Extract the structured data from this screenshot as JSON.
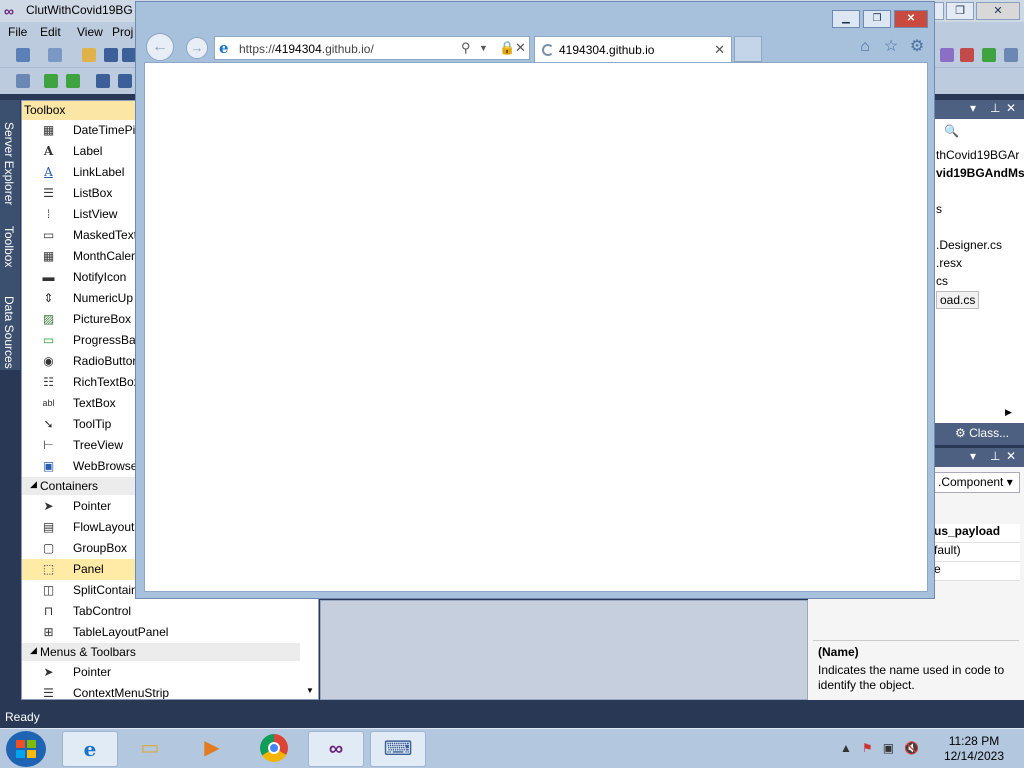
{
  "vs": {
    "title": "ClutWithCovid19BG",
    "menu": [
      "File",
      "Edit",
      "View",
      "Proj"
    ],
    "status": "Ready",
    "side_tabs": [
      "Server Explorer",
      "Toolbox",
      "Data Sources"
    ]
  },
  "toolbox": {
    "header": "Toolbox",
    "items_top": [
      {
        "icon": "datetimepicker-icon",
        "label": "DateTimePi"
      },
      {
        "icon": "label-icon",
        "label": "Label"
      },
      {
        "icon": "linklabel-icon",
        "label": "LinkLabel"
      },
      {
        "icon": "listbox-icon",
        "label": "ListBox"
      },
      {
        "icon": "listview-icon",
        "label": "ListView"
      },
      {
        "icon": "maskedtextbox-icon",
        "label": "MaskedText"
      },
      {
        "icon": "monthcalendar-icon",
        "label": "MonthCaler"
      },
      {
        "icon": "notifyicon-icon",
        "label": "NotifyIcon"
      },
      {
        "icon": "numericupdown-icon",
        "label": "NumericUp"
      },
      {
        "icon": "picturebox-icon",
        "label": "PictureBox"
      },
      {
        "icon": "progressbar-icon",
        "label": "ProgressBar"
      },
      {
        "icon": "radiobutton-icon",
        "label": "RadioButtor"
      },
      {
        "icon": "richtextbox-icon",
        "label": "RichTextBox"
      },
      {
        "icon": "textbox-icon",
        "label": "TextBox"
      },
      {
        "icon": "tooltip-icon",
        "label": "ToolTip"
      },
      {
        "icon": "treeview-icon",
        "label": "TreeView"
      },
      {
        "icon": "webbrowser-icon",
        "label": "WebBrowse"
      }
    ],
    "containers_label": "Containers",
    "containers": [
      {
        "icon": "pointer-icon",
        "label": "Pointer"
      },
      {
        "icon": "flowlayout-icon",
        "label": "FlowLayoutI"
      },
      {
        "icon": "groupbox-icon",
        "label": "GroupBox"
      },
      {
        "icon": "panel-icon",
        "label": "Panel"
      },
      {
        "icon": "splitcontainer-icon",
        "label": "SplitContair"
      },
      {
        "icon": "tabcontrol-icon",
        "label": "TabControl"
      },
      {
        "icon": "tablelayoutpanel-icon",
        "label": "TableLayoutPanel"
      }
    ],
    "menus_label": "Menus & Toolbars",
    "menus": [
      {
        "icon": "pointer-icon",
        "label": "Pointer"
      },
      {
        "icon": "contextmenustrip-icon",
        "label": "ContextMenuStrip"
      }
    ]
  },
  "solution": {
    "lines": [
      "thCovid19BGAr",
      "vid19BGAndMs",
      "s",
      ".Designer.cs",
      ".resx",
      "cs",
      "oad.cs"
    ],
    "tab_label": "Class..."
  },
  "properties": {
    "combo": ".Component",
    "rows": [
      "us_payload",
      "fault)",
      "e"
    ],
    "desc_title": "(Name)",
    "desc_text": "Indicates the name used in code to identify the object."
  },
  "browser": {
    "url_prefix": "https://",
    "url_host": "4194304",
    "url_suffix": ".github.io/",
    "tab_title": "4194304.github.io"
  },
  "taskbar": {
    "time": "11:28 PM",
    "date": "12/14/2023"
  },
  "colors": {
    "vs_chrome": "#293955",
    "toolbox_header": "#fbe6a6",
    "selection": "#ffeaa6",
    "taskbar": "#b3c7df"
  }
}
